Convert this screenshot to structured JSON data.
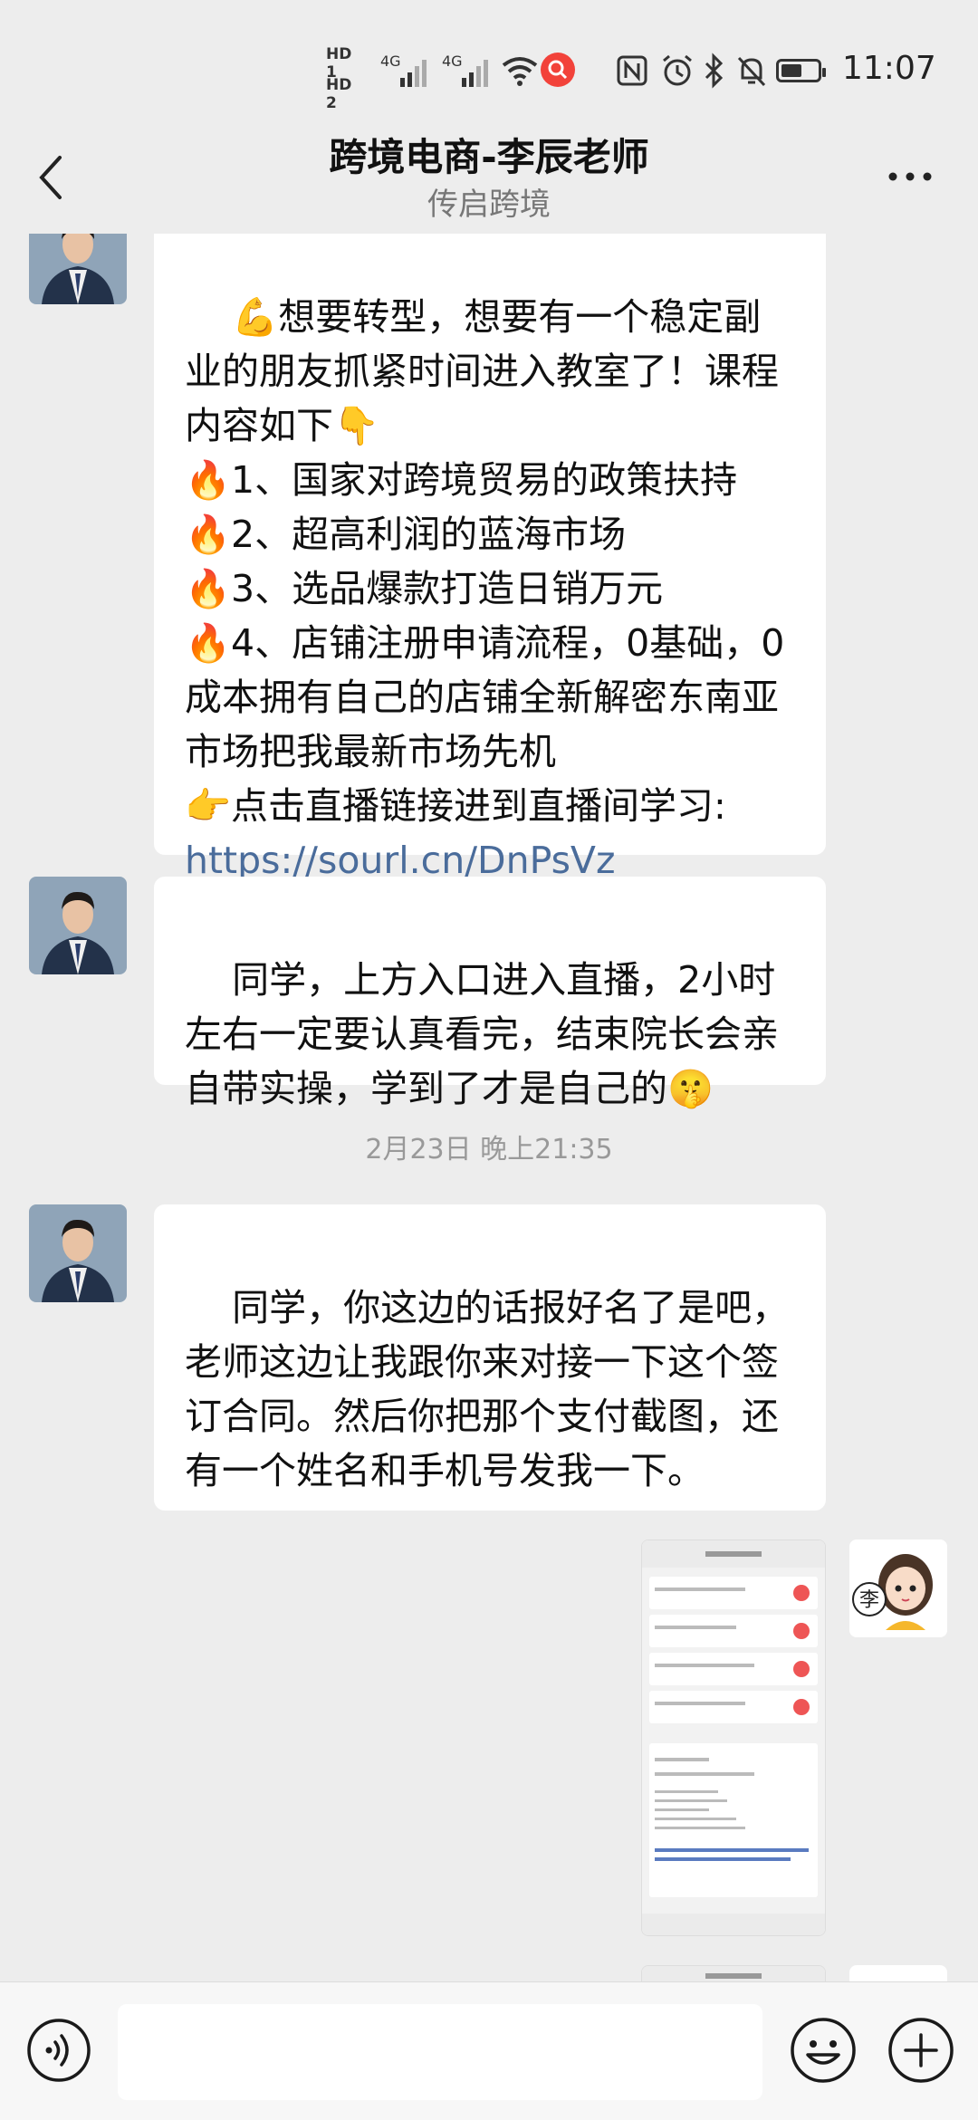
{
  "status_bar": {
    "hd1": "HD 1",
    "hd2": "HD 2",
    "sig1": "4G",
    "sig2": "4G",
    "time": "11:07"
  },
  "header": {
    "title": "跨境电商-李辰老师",
    "subtitle": "传启跨境"
  },
  "messages": [
    {
      "sender": "other",
      "text": "💪想要转型，想要有一个稳定副业的朋友抓紧时间进入教室了！课程内容如下👇\n🔥1、国家对跨境贸易的政策扶持\n🔥2、超高利润的蓝海市场\n🔥3、选品爆款打造日销万元\n🔥4、店铺注册申请流程，0基础，0成本拥有自己的店铺全新解密东南亚市场把我最新市场先机\n👉点击直播链接进到直播间学习:",
      "link": "https://sourl.cn/DnPsVz"
    },
    {
      "sender": "other",
      "text": "同学，上方入口进入直播，2小时左右一定要认真看完，结束院长会亲自带实操，学到了才是自己的🤫"
    },
    {
      "sender": "system",
      "text": "2月23日 晚上21:35"
    },
    {
      "sender": "other",
      "text": "同学，你这边的话报好名了是吧，老师这边让我跟你来对接一下这个签订合同。然后你把那个支付截图，还有一个姓名和手机号发我一下。"
    },
    {
      "sender": "self",
      "type": "image",
      "image_desc_icon": "screenshot-thumbnail",
      "avatar_char": "李"
    }
  ],
  "icons": {
    "back": "chevron-left-icon",
    "more": "more-dots-icon",
    "voice": "voice-icon",
    "emoji": "emoji-icon",
    "plus": "plus-icon"
  },
  "colors": {
    "background": "#ededed",
    "bubble": "#ffffff",
    "link": "#4a6c9b",
    "record": "#f2423a"
  }
}
